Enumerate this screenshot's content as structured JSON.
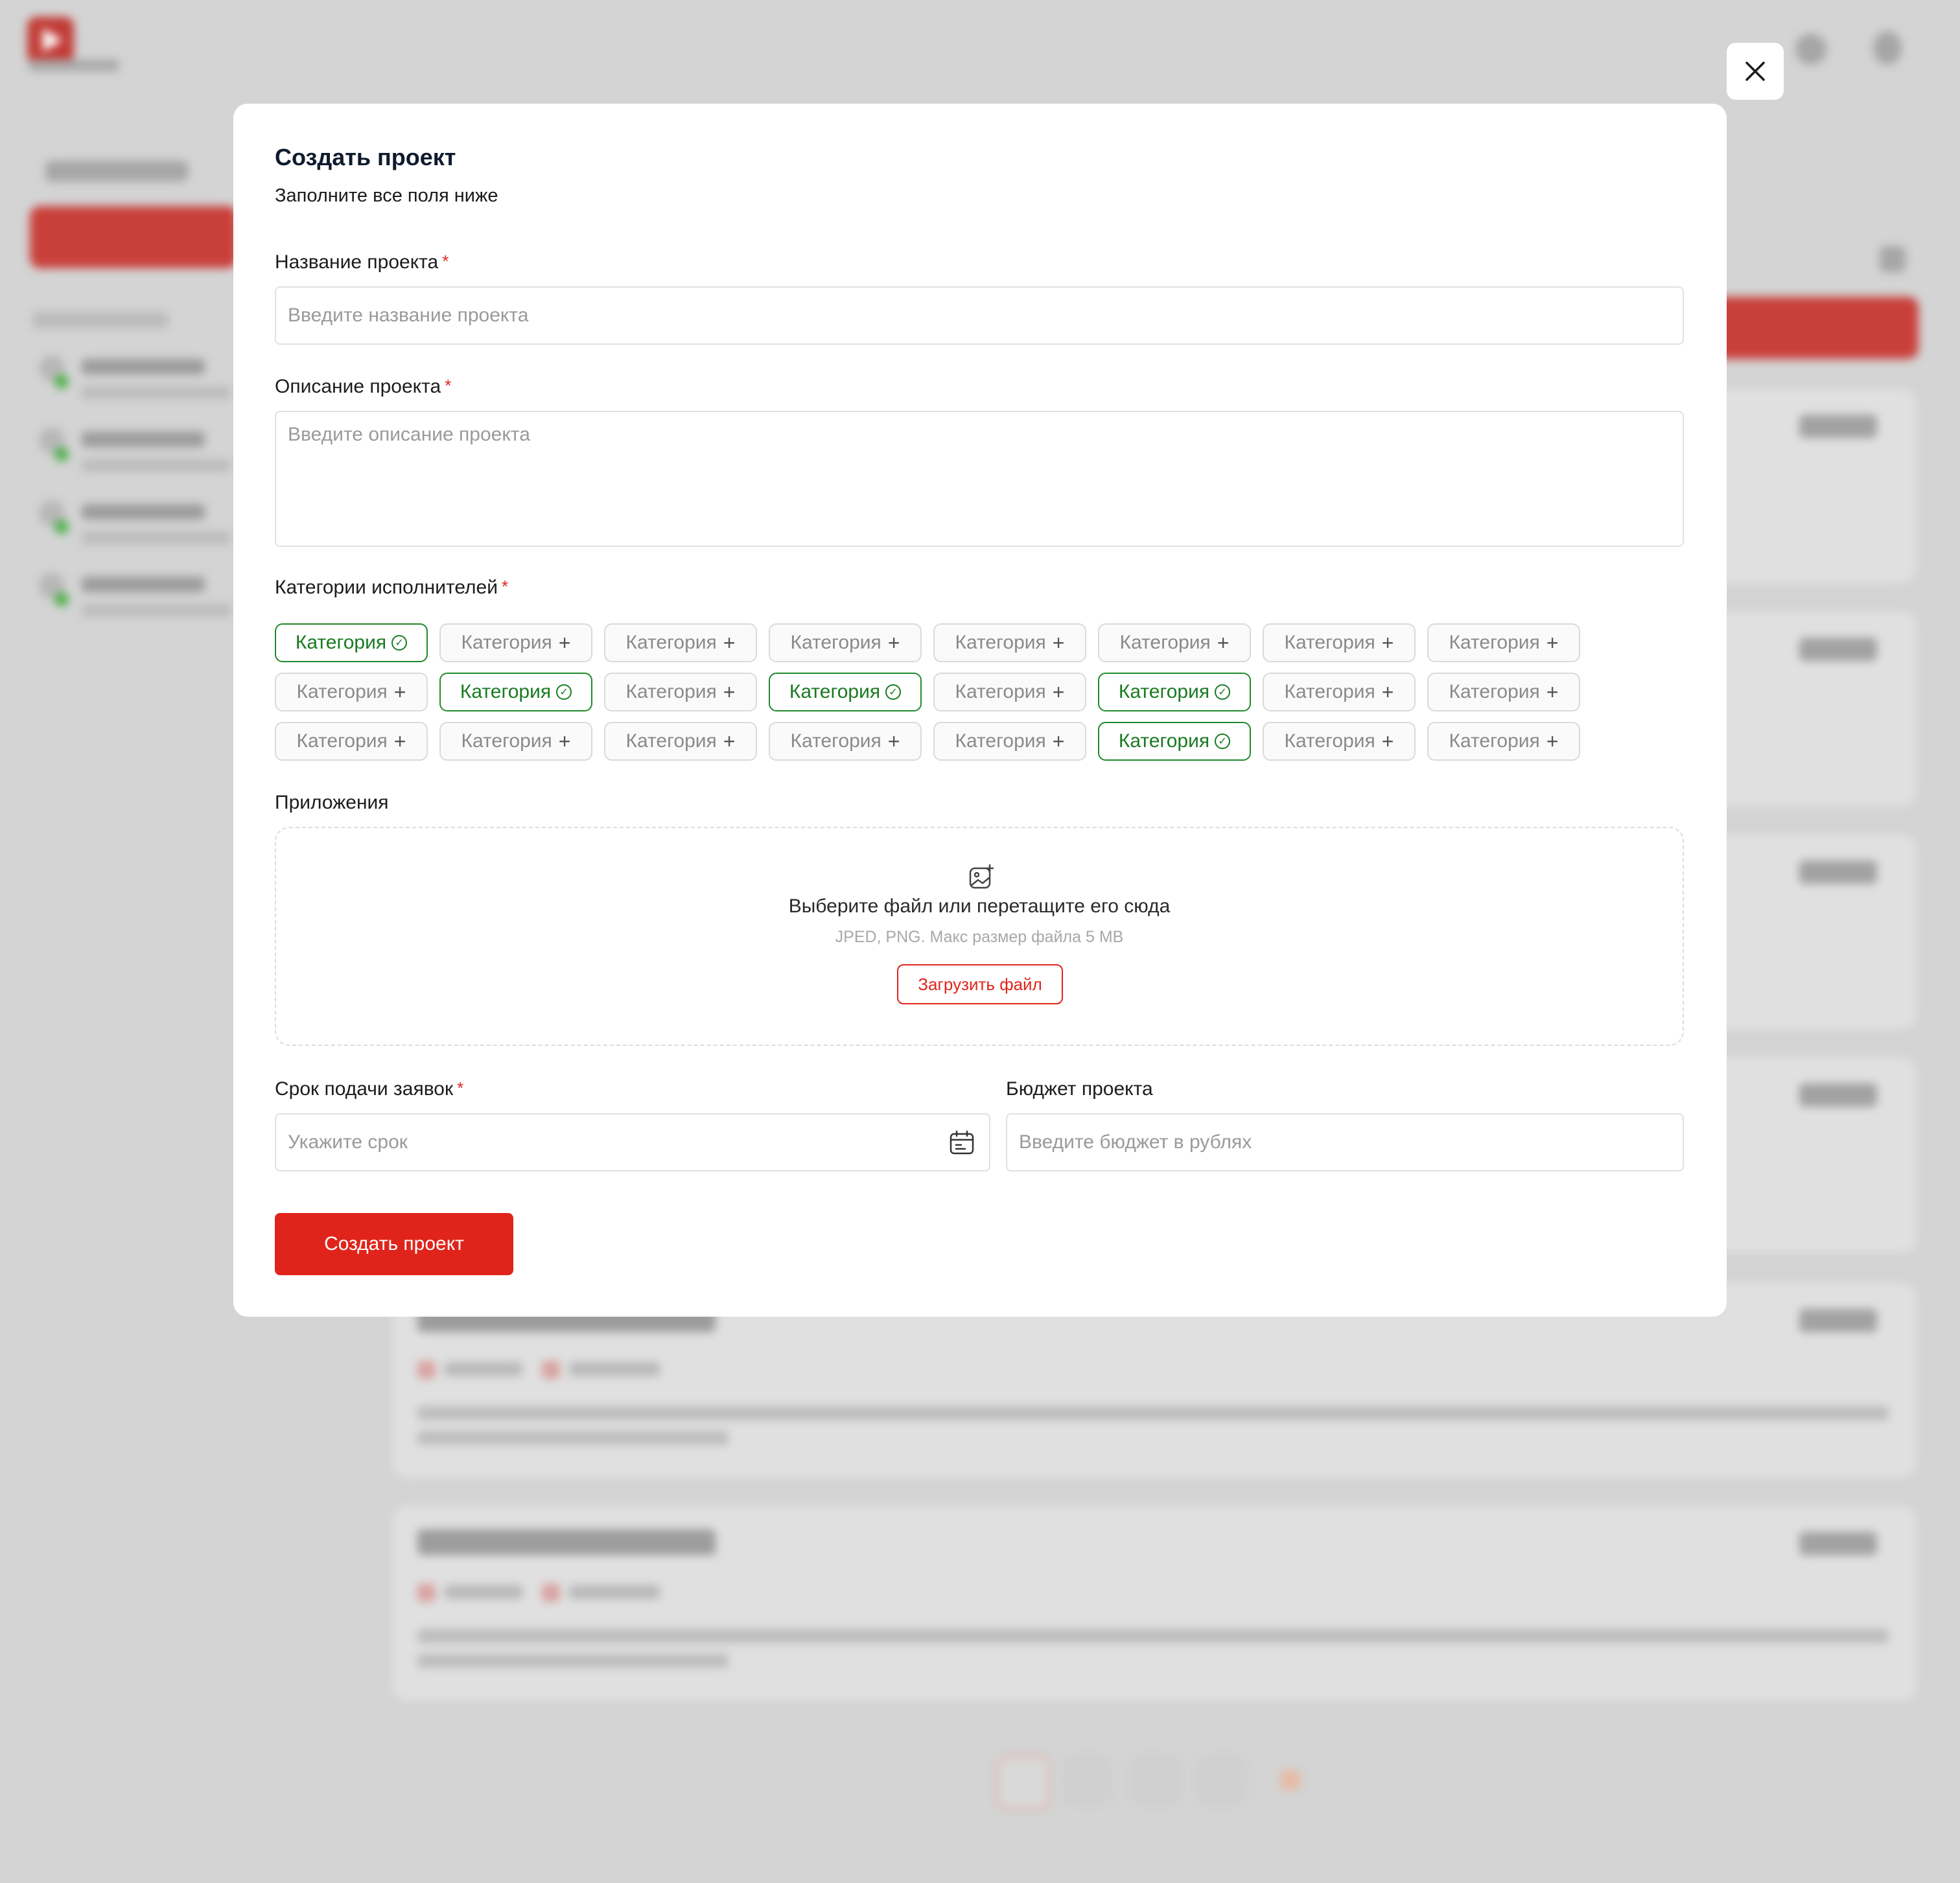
{
  "modal": {
    "title": "Создать проект",
    "subtitle": "Заполните все поля ниже",
    "required_mark": "*",
    "name_label": "Название проекта",
    "name_placeholder": "Введите название проекта",
    "description_label": "Описание проекта",
    "description_placeholder": "Введите описание проекта",
    "categories_label": "Категории исполнителей",
    "categories": [
      {
        "label": "Категория",
        "selected": true
      },
      {
        "label": "Категория",
        "selected": false
      },
      {
        "label": "Категория",
        "selected": false
      },
      {
        "label": "Категория",
        "selected": false
      },
      {
        "label": "Категория",
        "selected": false
      },
      {
        "label": "Категория",
        "selected": false
      },
      {
        "label": "Категория",
        "selected": false
      },
      {
        "label": "Категория",
        "selected": false
      },
      {
        "label": "Категория",
        "selected": false
      },
      {
        "label": "Категория",
        "selected": true
      },
      {
        "label": "Категория",
        "selected": false
      },
      {
        "label": "Категория",
        "selected": true
      },
      {
        "label": "Категория",
        "selected": false
      },
      {
        "label": "Категория",
        "selected": true
      },
      {
        "label": "Категория",
        "selected": false
      },
      {
        "label": "Категория",
        "selected": false
      },
      {
        "label": "Категория",
        "selected": false
      },
      {
        "label": "Категория",
        "selected": false
      },
      {
        "label": "Категория",
        "selected": false
      },
      {
        "label": "Категория",
        "selected": false
      },
      {
        "label": "Категория",
        "selected": false
      },
      {
        "label": "Категория",
        "selected": true
      },
      {
        "label": "Категория",
        "selected": false
      },
      {
        "label": "Категория",
        "selected": false
      }
    ],
    "attachments_label": "Приложения",
    "dropzone_title": "Выберите файл или перетащите его сюда",
    "dropzone_hint": "JPED, PNG. Макс размер файла 5 MB",
    "upload_button": "Загрузить файл",
    "deadline_label": "Срок подачи заявок",
    "deadline_placeholder": "Укажите срок",
    "budget_label": "Бюджет проекта",
    "budget_placeholder": "Введите бюджет в рублях",
    "submit_button": "Создать проект"
  },
  "colors": {
    "accent_red": "#e0241b",
    "selected_green": "#1a7a22",
    "overlay_grey": "#d4d4d4"
  }
}
